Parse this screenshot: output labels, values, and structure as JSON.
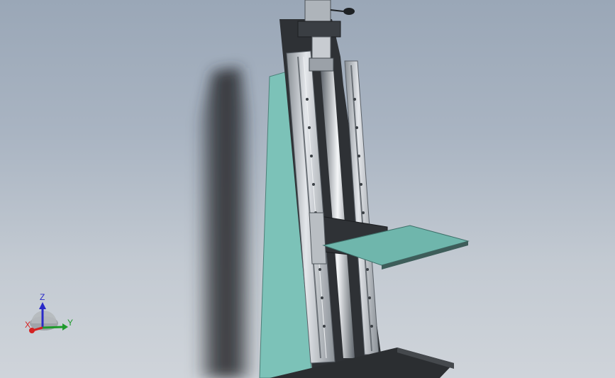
{
  "viewport": {
    "background_top": "#9aa7b7",
    "background_bottom": "#cfd4da"
  },
  "model": {
    "colors": {
      "base_plate": "#7cc2b8",
      "frame_dark": "#2e3135",
      "rail_light": "#d4d8dd",
      "screw_highlight": "#f4f6f8",
      "carriage_plate": "#6fb6ac",
      "shadow": "#2c2f33"
    }
  },
  "triad": {
    "z_label": "Z",
    "x_label": "X",
    "y_label": "Y",
    "z_color": "#2a2ac8",
    "x_color": "#d42222",
    "y_color": "#1f9a2c"
  }
}
